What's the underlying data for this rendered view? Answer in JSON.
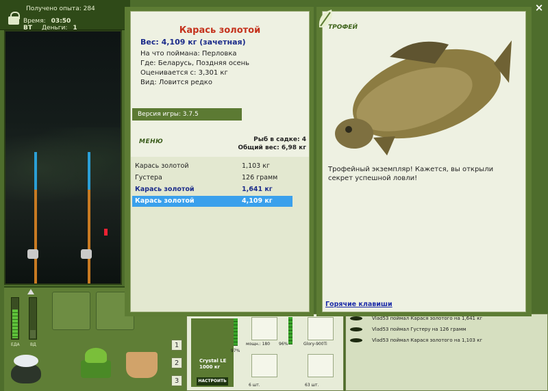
{
  "hud": {
    "experience_label": "Получено опыта: 284",
    "time_label": "Время:",
    "time_value": "03:50 ВТ",
    "money_label": "Деньги:",
    "money_value": "1"
  },
  "meters": {
    "food_label": "ЕДА",
    "water_label": "ВД",
    "food_level": 0.7,
    "water_level": 0.2
  },
  "bag_pages": [
    "1",
    "2",
    "3"
  ],
  "fish_card": {
    "name": "Карась золотой",
    "weight": "Вес: 4,109 кг (зачетная)",
    "caught_on": "На что поймана: Перловка",
    "where": "Где: Беларусь, Поздняя осень",
    "valued_from": "Оценивается с: 3,301 кг",
    "kind": "Вид: Ловится редко",
    "version": "Версия игры: 3.7.5",
    "menu_label": "МЕНЮ",
    "fish_in_keepnet": "Рыб в садке: 4",
    "total_weight": "Общий вес: 6,98 кг"
  },
  "catch_list": [
    {
      "name": "Карась золотой",
      "weight": "1,103 кг",
      "style": "normal"
    },
    {
      "name": "Густера",
      "weight": "126 грамм",
      "style": "normal"
    },
    {
      "name": "Карась золотой",
      "weight": "1,641 кг",
      "style": "bold"
    },
    {
      "name": "Карась золотой",
      "weight": "4,109 кг",
      "style": "selected"
    }
  ],
  "trophy": {
    "title": "ТРОФЕЙ",
    "description": "Трофейный экземпляр! Кажется, вы открыли секрет успешной ловли!",
    "hotkeys_link": "Горячие клавиши"
  },
  "tackle": {
    "rod_name": "Crystal LE",
    "rod_capacity": "1000 кг",
    "setup_button": "НАСТРОИТЬ",
    "rod_wear": "97%",
    "reel_power": "мощн.: 180",
    "reel_wear": "96%",
    "line_name": "Glory-900Ti",
    "hooks_count": "6 шт.",
    "bait_count": "63 шт."
  },
  "chat": [
    "Vlad53 поймал Карася золотого на 1,641 кг",
    "Vlad53 поймал Густеру на 126 грамм",
    "Vlad53 поймал Карася золотого на 1,103 кг"
  ],
  "close_symbol": "×"
}
